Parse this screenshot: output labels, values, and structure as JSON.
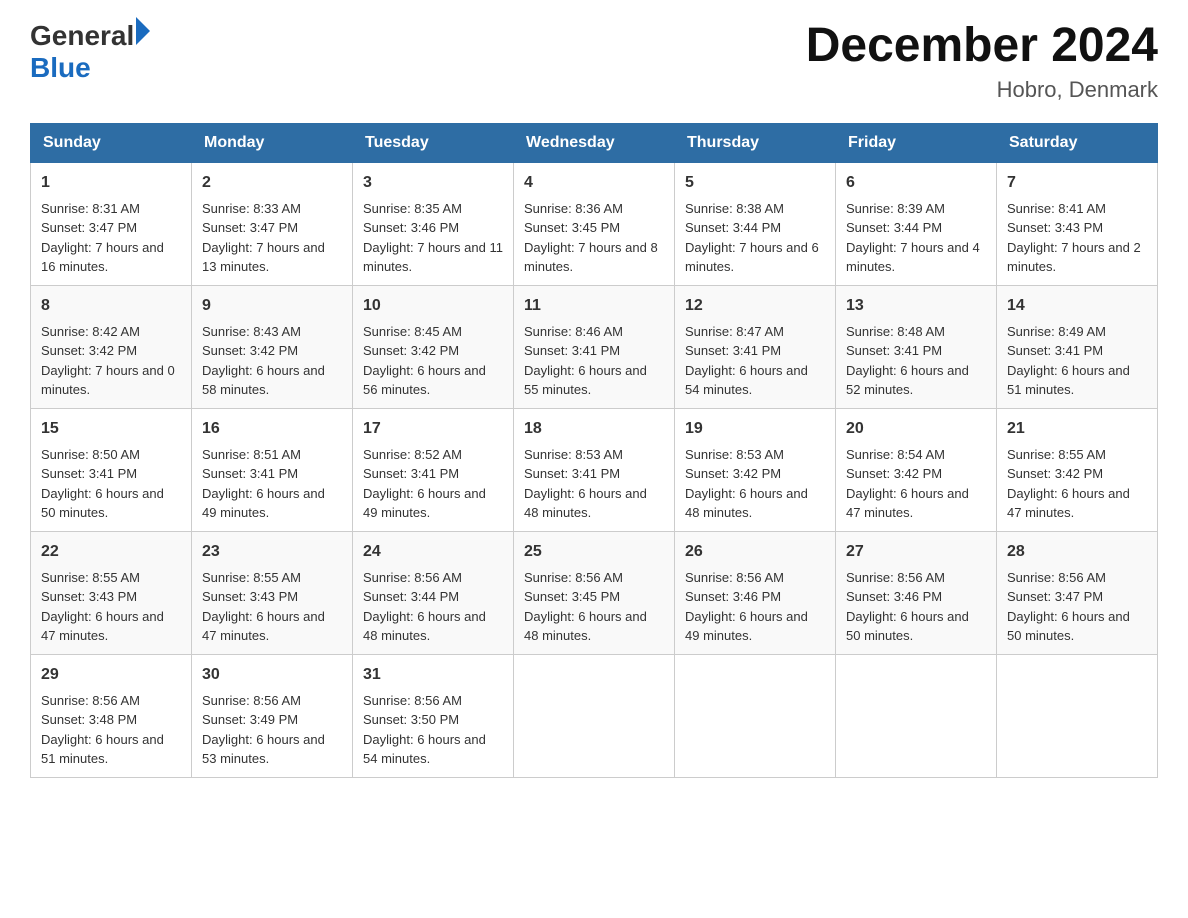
{
  "header": {
    "logo_general": "General",
    "logo_blue": "Blue",
    "month_title": "December 2024",
    "location": "Hobro, Denmark"
  },
  "days_of_week": [
    "Sunday",
    "Monday",
    "Tuesday",
    "Wednesday",
    "Thursday",
    "Friday",
    "Saturday"
  ],
  "weeks": [
    [
      {
        "day": "1",
        "sunrise": "8:31 AM",
        "sunset": "3:47 PM",
        "daylight": "7 hours and 16 minutes."
      },
      {
        "day": "2",
        "sunrise": "8:33 AM",
        "sunset": "3:47 PM",
        "daylight": "7 hours and 13 minutes."
      },
      {
        "day": "3",
        "sunrise": "8:35 AM",
        "sunset": "3:46 PM",
        "daylight": "7 hours and 11 minutes."
      },
      {
        "day": "4",
        "sunrise": "8:36 AM",
        "sunset": "3:45 PM",
        "daylight": "7 hours and 8 minutes."
      },
      {
        "day": "5",
        "sunrise": "8:38 AM",
        "sunset": "3:44 PM",
        "daylight": "7 hours and 6 minutes."
      },
      {
        "day": "6",
        "sunrise": "8:39 AM",
        "sunset": "3:44 PM",
        "daylight": "7 hours and 4 minutes."
      },
      {
        "day": "7",
        "sunrise": "8:41 AM",
        "sunset": "3:43 PM",
        "daylight": "7 hours and 2 minutes."
      }
    ],
    [
      {
        "day": "8",
        "sunrise": "8:42 AM",
        "sunset": "3:42 PM",
        "daylight": "7 hours and 0 minutes."
      },
      {
        "day": "9",
        "sunrise": "8:43 AM",
        "sunset": "3:42 PM",
        "daylight": "6 hours and 58 minutes."
      },
      {
        "day": "10",
        "sunrise": "8:45 AM",
        "sunset": "3:42 PM",
        "daylight": "6 hours and 56 minutes."
      },
      {
        "day": "11",
        "sunrise": "8:46 AM",
        "sunset": "3:41 PM",
        "daylight": "6 hours and 55 minutes."
      },
      {
        "day": "12",
        "sunrise": "8:47 AM",
        "sunset": "3:41 PM",
        "daylight": "6 hours and 54 minutes."
      },
      {
        "day": "13",
        "sunrise": "8:48 AM",
        "sunset": "3:41 PM",
        "daylight": "6 hours and 52 minutes."
      },
      {
        "day": "14",
        "sunrise": "8:49 AM",
        "sunset": "3:41 PM",
        "daylight": "6 hours and 51 minutes."
      }
    ],
    [
      {
        "day": "15",
        "sunrise": "8:50 AM",
        "sunset": "3:41 PM",
        "daylight": "6 hours and 50 minutes."
      },
      {
        "day": "16",
        "sunrise": "8:51 AM",
        "sunset": "3:41 PM",
        "daylight": "6 hours and 49 minutes."
      },
      {
        "day": "17",
        "sunrise": "8:52 AM",
        "sunset": "3:41 PM",
        "daylight": "6 hours and 49 minutes."
      },
      {
        "day": "18",
        "sunrise": "8:53 AM",
        "sunset": "3:41 PM",
        "daylight": "6 hours and 48 minutes."
      },
      {
        "day": "19",
        "sunrise": "8:53 AM",
        "sunset": "3:42 PM",
        "daylight": "6 hours and 48 minutes."
      },
      {
        "day": "20",
        "sunrise": "8:54 AM",
        "sunset": "3:42 PM",
        "daylight": "6 hours and 47 minutes."
      },
      {
        "day": "21",
        "sunrise": "8:55 AM",
        "sunset": "3:42 PM",
        "daylight": "6 hours and 47 minutes."
      }
    ],
    [
      {
        "day": "22",
        "sunrise": "8:55 AM",
        "sunset": "3:43 PM",
        "daylight": "6 hours and 47 minutes."
      },
      {
        "day": "23",
        "sunrise": "8:55 AM",
        "sunset": "3:43 PM",
        "daylight": "6 hours and 47 minutes."
      },
      {
        "day": "24",
        "sunrise": "8:56 AM",
        "sunset": "3:44 PM",
        "daylight": "6 hours and 48 minutes."
      },
      {
        "day": "25",
        "sunrise": "8:56 AM",
        "sunset": "3:45 PM",
        "daylight": "6 hours and 48 minutes."
      },
      {
        "day": "26",
        "sunrise": "8:56 AM",
        "sunset": "3:46 PM",
        "daylight": "6 hours and 49 minutes."
      },
      {
        "day": "27",
        "sunrise": "8:56 AM",
        "sunset": "3:46 PM",
        "daylight": "6 hours and 50 minutes."
      },
      {
        "day": "28",
        "sunrise": "8:56 AM",
        "sunset": "3:47 PM",
        "daylight": "6 hours and 50 minutes."
      }
    ],
    [
      {
        "day": "29",
        "sunrise": "8:56 AM",
        "sunset": "3:48 PM",
        "daylight": "6 hours and 51 minutes."
      },
      {
        "day": "30",
        "sunrise": "8:56 AM",
        "sunset": "3:49 PM",
        "daylight": "6 hours and 53 minutes."
      },
      {
        "day": "31",
        "sunrise": "8:56 AM",
        "sunset": "3:50 PM",
        "daylight": "6 hours and 54 minutes."
      },
      null,
      null,
      null,
      null
    ]
  ],
  "labels": {
    "sunrise": "Sunrise:",
    "sunset": "Sunset:",
    "daylight": "Daylight:"
  }
}
